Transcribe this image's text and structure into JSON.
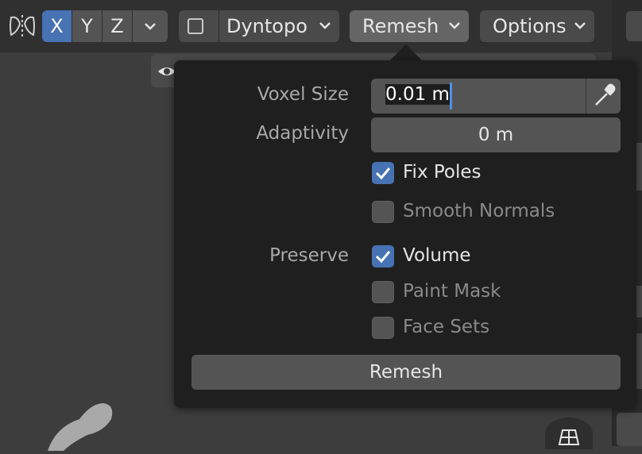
{
  "header": {
    "axes": [
      "X",
      "Y",
      "Z"
    ],
    "dyntopo_label": "Dyntopo",
    "remesh_menu_label": "Remesh",
    "options_label": "Options"
  },
  "remesh_popover": {
    "voxel_size_label": "Voxel Size",
    "voxel_size_value": "0.01 m",
    "adaptivity_label": "Adaptivity",
    "adaptivity_value": "0 m",
    "fix_poles_label": "Fix Poles",
    "fix_poles_checked": true,
    "smooth_normals_label": "Smooth Normals",
    "smooth_normals_checked": false,
    "preserve_label": "Preserve",
    "volume_label": "Volume",
    "volume_checked": true,
    "paint_mask_label": "Paint Mask",
    "paint_mask_checked": false,
    "face_sets_label": "Face Sets",
    "face_sets_checked": false,
    "remesh_button_label": "Remesh"
  },
  "colors": {
    "accent": "#4772b3",
    "popover_bg": "#1f1f1f",
    "header_bg": "#303030"
  }
}
